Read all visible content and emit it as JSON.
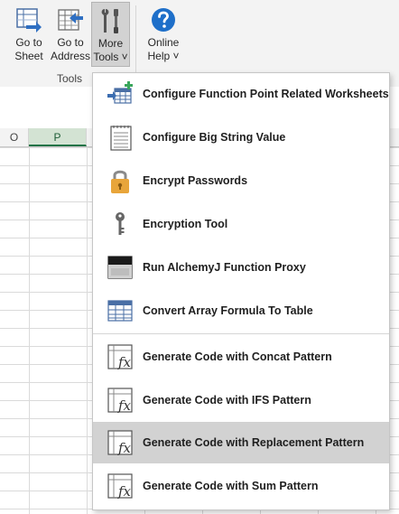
{
  "ribbon": {
    "buttons": [
      {
        "line1": "Go to",
        "line2": "Sheet"
      },
      {
        "line1": "Go to",
        "line2": "Address"
      },
      {
        "line1": "More",
        "line2": "Tools ˅"
      },
      {
        "line1": "Online",
        "line2": "Help ˅"
      }
    ],
    "group_label": "Tools"
  },
  "sheet": {
    "columns": [
      "O",
      "P"
    ]
  },
  "menu": {
    "items": [
      {
        "label": "Configure Function Point Related Worksheets",
        "icon": "add-worksheet-icon"
      },
      {
        "label": "Configure Big String Value",
        "icon": "notepad-icon"
      },
      {
        "label": "Encrypt Passwords",
        "icon": "padlock-icon"
      },
      {
        "label": "Encryption Tool",
        "icon": "key-icon"
      },
      {
        "label": "Run AlchemyJ Function Proxy",
        "icon": "proxy-window-icon"
      },
      {
        "label": "Convert Array Formula To Table",
        "icon": "table-icon"
      },
      {
        "label": "Generate Code with Concat Pattern",
        "icon": "function-code-icon"
      },
      {
        "label": "Generate Code with IFS Pattern",
        "icon": "function-code-icon"
      },
      {
        "label": "Generate Code with Replacement Pattern",
        "icon": "function-code-icon"
      },
      {
        "label": "Generate Code with Sum Pattern",
        "icon": "function-code-icon"
      }
    ],
    "highlighted_index": 8
  },
  "colors": {
    "accent_green": "#217346",
    "help_blue": "#1e6fc9",
    "highlight": "#d2d2d2"
  }
}
